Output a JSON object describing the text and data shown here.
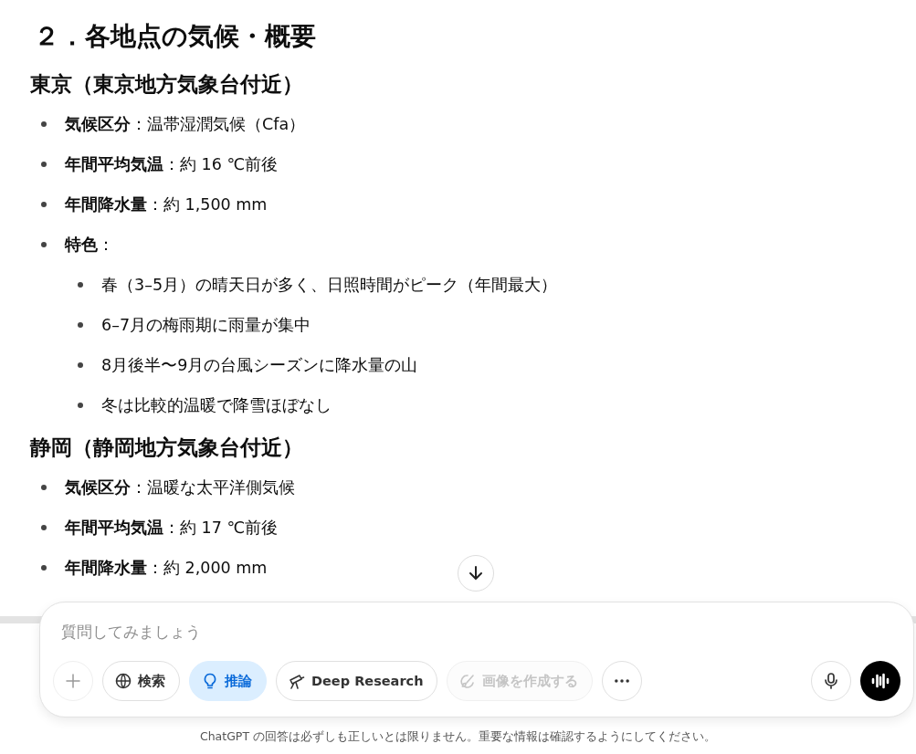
{
  "article": {
    "heading": "２．各地点の気候・概要",
    "sections": [
      {
        "title": "東京（東京地方気象台付近）",
        "items": [
          {
            "kind": "text",
            "text": "**気候区分**：温帯湿潤気候（Cfa）"
          },
          {
            "kind": "text",
            "text": "**年間平均気温**：約 16 ℃前後"
          },
          {
            "kind": "text",
            "text": "**年間降水量**：約 1,500 mm"
          },
          {
            "kind": "group",
            "text": "**特色**：",
            "children": [
              {
                "text": "春（3–5月）の晴天日が多く、日照時間がピーク（年間最大）"
              },
              {
                "text": "6–7月の梅雨期に雨量が集中"
              },
              {
                "text": "8月後半〜9月の台風シーズンに降水量の山"
              },
              {
                "text": "冬は比較的温暖で降雪ほぼなし"
              }
            ]
          }
        ]
      },
      {
        "title": "静岡（静岡地方気象台付近）",
        "items": [
          {
            "kind": "text",
            "text": "**気候区分**：温暖な太平洋側気候"
          },
          {
            "kind": "text",
            "text": "**年間平均気温**：約 17 ℃前後"
          },
          {
            "kind": "text",
            "text": "**年間降水量**：約 2,000 mm"
          }
        ]
      }
    ]
  },
  "composer": {
    "placeholder": "質問してみましょう",
    "tools": [
      {
        "kind": "plus",
        "selected": false,
        "disabled": false
      },
      {
        "kind": "globe",
        "label": "検索",
        "selected": false,
        "disabled": false
      },
      {
        "kind": "bulb",
        "label": "推論",
        "selected": true,
        "disabled": false
      },
      {
        "kind": "telescope",
        "label": "Deep Research",
        "selected": false,
        "disabled": false
      },
      {
        "kind": "brush",
        "label": "画像を作成する",
        "selected": false,
        "disabled": true
      },
      {
        "kind": "more",
        "selected": false,
        "disabled": false
      }
    ]
  },
  "disclaimer": "ChatGPT の回答は必ずしも正しいとは限りません。重要な情報は確認するようにしてください。"
}
